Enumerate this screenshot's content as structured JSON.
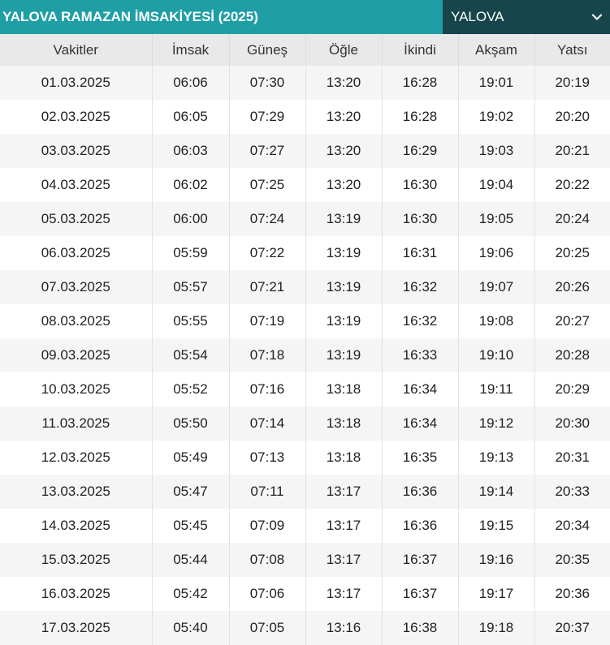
{
  "header": {
    "title": "YALOVA RAMAZAN İMSAKİYESİ (2025)",
    "city_select": {
      "selected": "YALOVA"
    }
  },
  "colors": {
    "title_bar": "#1f9ea6",
    "select_bg": "#16464b",
    "header_row": "#e9e9e9",
    "stripe": "#f5f5f5"
  },
  "icons": {
    "select_arrow": "chevron-down-icon"
  },
  "table": {
    "columns": [
      "Vakitler",
      "İmsak",
      "Güneş",
      "Öğle",
      "İkindi",
      "Akşam",
      "Yatsı"
    ],
    "rows": [
      [
        "01.03.2025",
        "06:06",
        "07:30",
        "13:20",
        "16:28",
        "19:01",
        "20:19"
      ],
      [
        "02.03.2025",
        "06:05",
        "07:29",
        "13:20",
        "16:28",
        "19:02",
        "20:20"
      ],
      [
        "03.03.2025",
        "06:03",
        "07:27",
        "13:20",
        "16:29",
        "19:03",
        "20:21"
      ],
      [
        "04.03.2025",
        "06:02",
        "07:25",
        "13:20",
        "16:30",
        "19:04",
        "20:22"
      ],
      [
        "05.03.2025",
        "06:00",
        "07:24",
        "13:19",
        "16:30",
        "19:05",
        "20:24"
      ],
      [
        "06.03.2025",
        "05:59",
        "07:22",
        "13:19",
        "16:31",
        "19:06",
        "20:25"
      ],
      [
        "07.03.2025",
        "05:57",
        "07:21",
        "13:19",
        "16:32",
        "19:07",
        "20:26"
      ],
      [
        "08.03.2025",
        "05:55",
        "07:19",
        "13:19",
        "16:32",
        "19:08",
        "20:27"
      ],
      [
        "09.03.2025",
        "05:54",
        "07:18",
        "13:19",
        "16:33",
        "19:10",
        "20:28"
      ],
      [
        "10.03.2025",
        "05:52",
        "07:16",
        "13:18",
        "16:34",
        "19:11",
        "20:29"
      ],
      [
        "11.03.2025",
        "05:50",
        "07:14",
        "13:18",
        "16:34",
        "19:12",
        "20:30"
      ],
      [
        "12.03.2025",
        "05:49",
        "07:13",
        "13:18",
        "16:35",
        "19:13",
        "20:31"
      ],
      [
        "13.03.2025",
        "05:47",
        "07:11",
        "13:17",
        "16:36",
        "19:14",
        "20:33"
      ],
      [
        "14.03.2025",
        "05:45",
        "07:09",
        "13:17",
        "16:36",
        "19:15",
        "20:34"
      ],
      [
        "15.03.2025",
        "05:44",
        "07:08",
        "13:17",
        "16:37",
        "19:16",
        "20:35"
      ],
      [
        "16.03.2025",
        "05:42",
        "07:06",
        "13:17",
        "16:37",
        "19:17",
        "20:36"
      ],
      [
        "17.03.2025",
        "05:40",
        "07:05",
        "13:16",
        "16:38",
        "19:18",
        "20:37"
      ]
    ]
  }
}
